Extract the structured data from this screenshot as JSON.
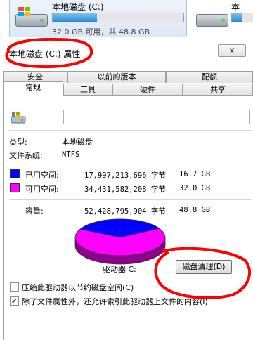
{
  "explorer": {
    "drive_c": {
      "name": "本地磁盘 (C:)",
      "usage_text": "32.0 GB 可用，共 48.8 GB",
      "used_fraction": 0.34
    },
    "drive_next": {
      "name": "本",
      "used_fraction": 0.4
    }
  },
  "dialog": {
    "title": "本地磁盘 (C:) 属性",
    "close_label": "x",
    "tabs_row_top": [
      "安全",
      "以前的版本",
      "配额"
    ],
    "tabs_row_bottom": [
      "常规",
      "工具",
      "硬件",
      "共享"
    ],
    "active_tab": "常规",
    "volume_name_value": "",
    "type_label": "类型:",
    "type_value": "本地磁盘",
    "fs_label": "文件系统:",
    "fs_value": "NTFS",
    "used": {
      "label": "已用空间:",
      "bytes": "17,997,213,696 字节",
      "gb": "16.7 GB",
      "color": "#0000ff"
    },
    "free": {
      "label": "可用空间:",
      "bytes": "34,431,582,208 字节",
      "gb": "32.0 GB",
      "color": "#ff00ff"
    },
    "capacity": {
      "label": "容量:",
      "bytes": "52,428,795,904 字节",
      "gb": "48.8 GB"
    },
    "drive_label": "驱动器 C:",
    "cleanup_button": "磁盘清理(D)",
    "compress_checkbox": {
      "label": "压缩此驱动器以节约磁盘空间(C)",
      "checked": false
    },
    "index_checkbox": {
      "label": "除了文件属性外，还允许索引此驱动器上文件的内容(I)",
      "checked": true
    },
    "pie": {
      "used_fraction": 0.343,
      "used_color": "#0000ff",
      "free_color": "#ff00ff"
    }
  },
  "annotation": {
    "color": "#ff0000"
  }
}
